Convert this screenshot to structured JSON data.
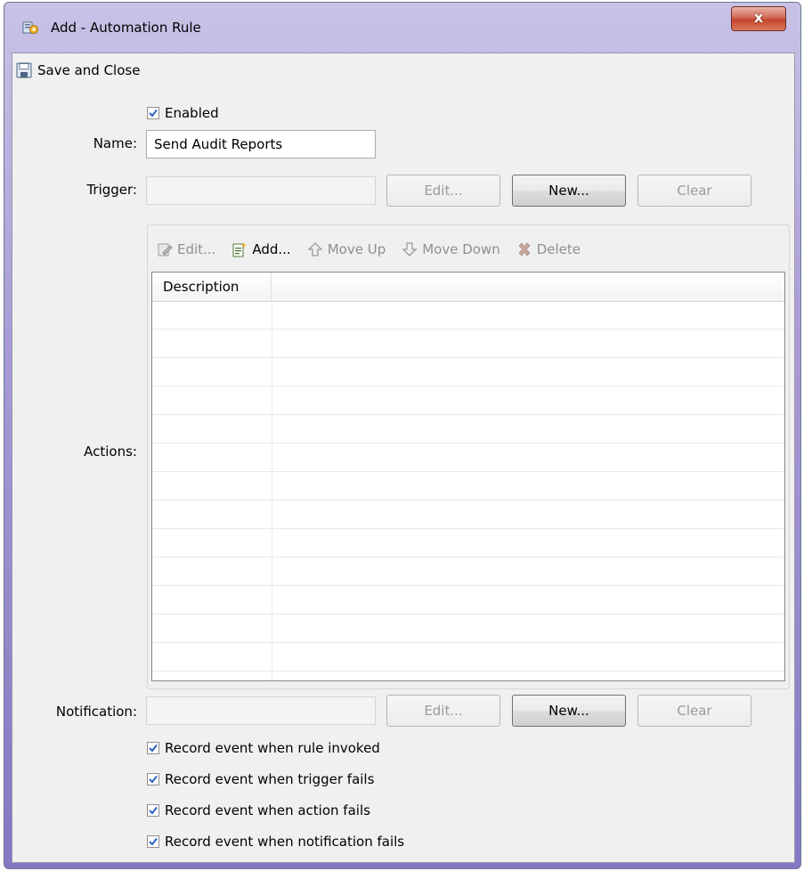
{
  "window": {
    "title": "Add - Automation Rule",
    "close_glyph": "x"
  },
  "toolbar": {
    "save_close_label": "Save and Close"
  },
  "form": {
    "enabled_label": "Enabled",
    "enabled_checked": true,
    "name_label": "Name:",
    "name_value": "Send Audit Reports",
    "trigger_label": "Trigger:",
    "trigger_value": "",
    "actions_label": "Actions:",
    "notification_label": "Notification:",
    "notification_value": ""
  },
  "buttons": {
    "edit": "Edit...",
    "new": "New...",
    "clear": "Clear"
  },
  "actions_toolbar": {
    "edit": "Edit...",
    "add": "Add...",
    "move_up": "Move Up",
    "move_down": "Move Down",
    "delete": "Delete"
  },
  "grid": {
    "columns": [
      "Description",
      ""
    ],
    "rows": []
  },
  "options": [
    {
      "label": "Record event when rule invoked",
      "checked": true
    },
    {
      "label": "Record event when trigger fails",
      "checked": true
    },
    {
      "label": "Record event when action fails",
      "checked": true
    },
    {
      "label": "Record event when notification fails",
      "checked": true
    }
  ],
  "icons": {
    "app": "automation-rule-icon",
    "save": "floppy-disk-icon",
    "edit": "pencil-icon",
    "add": "add-document-icon",
    "move_up": "arrow-up-icon",
    "move_down": "arrow-down-icon",
    "delete": "delete-x-icon"
  },
  "colors": {
    "accent": "#2a62c4",
    "titlebar": "#a99ad6",
    "close": "#c4442d"
  }
}
